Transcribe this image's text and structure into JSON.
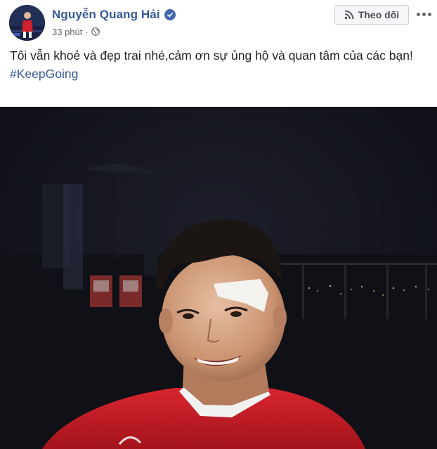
{
  "post": {
    "author": "Nguyễn Quang Hải",
    "verified": true,
    "timestamp": "33 phút",
    "separator": "·",
    "privacy_icon": "globe-icon",
    "follow_label": "Theo dõi",
    "message": "Tôi vẫn khoẻ và đẹp trai nhé,cảm ơn sự ủng hộ và quan tâm của các bạn!",
    "hashtag": "#KeepGoing",
    "photo_alt": "photo",
    "colors": {
      "link": "#385898",
      "verified_badge": "#4267b2",
      "button_bg": "#f5f6f7",
      "meta_text": "#616770"
    }
  }
}
